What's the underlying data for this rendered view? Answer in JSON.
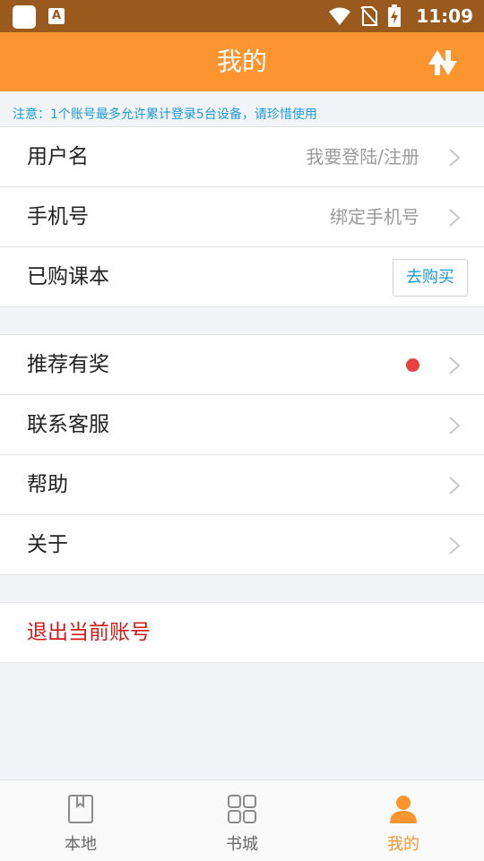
{
  "status_bar": {
    "app_badge": "A",
    "time": "11:09"
  },
  "header": {
    "title": "我的",
    "sync_icon": "sync-arrows-icon"
  },
  "notice": "注意：1个账号最多允许累计登录5台设备，请珍惜使用",
  "account": {
    "username": {
      "label": "用户名",
      "value": "我要登陆/注册"
    },
    "phone": {
      "label": "手机号",
      "value": "绑定手机号"
    },
    "purchased": {
      "label": "已购课本",
      "button": "去购买"
    }
  },
  "menu": {
    "recommend": {
      "label": "推荐有奖",
      "badge_color": "#e94040"
    },
    "contact": {
      "label": "联系客服"
    },
    "help": {
      "label": "帮助"
    },
    "about": {
      "label": "关于"
    }
  },
  "logout": {
    "label": "退出当前账号"
  },
  "tabs": [
    {
      "label": "本地",
      "icon": "bookmark-book-icon",
      "active": false
    },
    {
      "label": "书城",
      "icon": "grid-icon",
      "active": false
    },
    {
      "label": "我的",
      "icon": "person-icon",
      "active": true
    }
  ],
  "colors": {
    "header": "#fa952f",
    "status_bar": "#9a5a1d",
    "accent_blue": "#1a9bd8",
    "logout_red": "#d01a1a"
  }
}
